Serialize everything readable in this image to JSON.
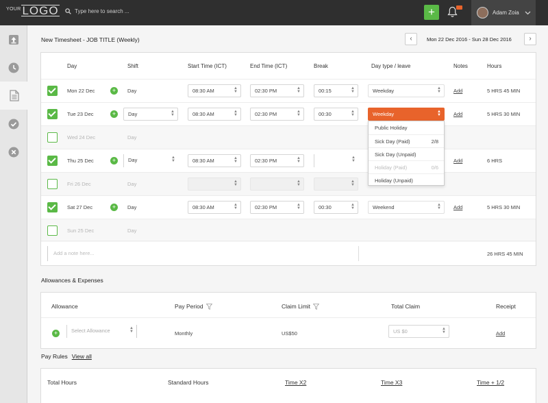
{
  "header": {
    "logo_small": "YOUR",
    "logo_big": "LOGO",
    "search_placeholder": "Type here to search ...",
    "add_label": "+",
    "user_name": "Adam Zoia"
  },
  "page": {
    "title": "New Timesheet - JOB TITLE (Weekly)",
    "date_range": "Mon 22 Dec 2016 - Sun 28 Dec 2016"
  },
  "timesheet": {
    "columns": [
      "Day",
      "Shift",
      "Start Time (ICT)",
      "End Time (ICT)",
      "Break",
      "Day type / leave",
      "Notes",
      "Hours"
    ],
    "rows": [
      {
        "checked": true,
        "day": "Mon 22 Dec",
        "shift": "Day",
        "start": "08:30 AM",
        "end": "02:30 PM",
        "break": "00:15",
        "day_type": "Weekday",
        "notes": "Add",
        "hours": "5 HRS 45 MIN"
      },
      {
        "checked": true,
        "day": "Tue 23 Dec",
        "shift": "Day",
        "start": "08:30 AM",
        "end": "02:30 PM",
        "break": "00:30",
        "day_type": "Weekday",
        "notes": "Add",
        "hours": "5 HRS 30 MIN"
      },
      {
        "checked": false,
        "day": "Wed 24 Dec",
        "shift": "Day",
        "start": "",
        "end": "",
        "break": "",
        "day_type": "",
        "notes": "",
        "hours": ""
      },
      {
        "checked": true,
        "day": "Thu 25 Dec",
        "shift": "Day",
        "start": "08:30 AM",
        "end": "02:30 PM",
        "break": "",
        "day_type": "",
        "notes": "Add",
        "hours": "6 HRS"
      },
      {
        "checked": false,
        "day": "Fri 26 Dec",
        "shift": "Day",
        "start": "",
        "end": "",
        "break": "",
        "day_type": "",
        "notes": "",
        "hours": ""
      },
      {
        "checked": true,
        "day": "Sat 27 Dec",
        "shift": "Day",
        "start": "08:30 AM",
        "end": "02:30 PM",
        "break": "00:30",
        "day_type": "Weekend",
        "notes": "Add",
        "hours": "5 HRS 30 MIN"
      },
      {
        "checked": false,
        "day": "Sun 25 Dec",
        "shift": "Day",
        "start": "",
        "end": "",
        "break": "",
        "day_type": "",
        "notes": "",
        "hours": ""
      }
    ],
    "dropdown": [
      {
        "label": "Public Holiday",
        "count": "",
        "disabled": false
      },
      {
        "label": "Sick Day (Paid)",
        "count": "2/8",
        "disabled": false
      },
      {
        "label": "Sick Day (Unpaid)",
        "count": "",
        "disabled": false
      },
      {
        "label": "Holiday (Paid)",
        "count": "0/6",
        "disabled": true
      },
      {
        "label": "Holiday (Unpaid)",
        "count": "",
        "disabled": false
      }
    ],
    "note_placeholder": "Add a note here...",
    "total": "26 HRS 45 MIN"
  },
  "allowances": {
    "title": "Allowances & Expenses",
    "columns": {
      "allowance": "Allowance",
      "pay_period": "Pay Period",
      "claim_limit": "Claim Limit",
      "total_claim": "Total Claim",
      "receipt": "Receipt"
    },
    "row": {
      "select_placeholder": "Select Allowance",
      "pay_period": "Monthly",
      "claim_limit": "US$50",
      "total_placeholder": "US $0",
      "receipt": "Add"
    }
  },
  "pay_rules": {
    "title": "Pay Rules",
    "view_all": "View all",
    "columns": {
      "total": "Total Hours",
      "standard": "Standard Hours",
      "x2": "Time X2",
      "x3": "Time X3",
      "half": "Time + 1/2"
    }
  },
  "colors": {
    "accent": "#5ab946",
    "orange": "#e8632b",
    "topbar": "#2f2f2f"
  }
}
